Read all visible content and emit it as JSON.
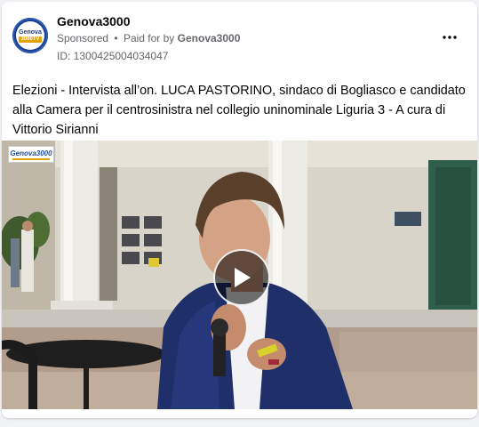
{
  "post": {
    "page_name": "Genova3000",
    "sponsored_label": "Sponsored",
    "paid_prefix": "Paid for by",
    "payer": "Genova3000",
    "ad_id": "ID: 1300425004034047",
    "more_icon": "more-dots-icon",
    "text": "Elezioni - Intervista all’on. LUCA PASTORINO, sindaco di Bogliasco e candidato alla Camera per il centrosinistra nel collegio uninominale Liguria 3 - A cura di Vittorio Sirianni"
  },
  "avatar": {
    "line1": "Genova",
    "line2": "3000TV"
  },
  "video": {
    "watermark": "Genova3000",
    "play_icon": "play-icon"
  },
  "colors": {
    "brand_blue": "#1c3f8f",
    "brand_yellow": "#e2a200",
    "text_primary": "#050505",
    "text_secondary": "#65676b"
  }
}
